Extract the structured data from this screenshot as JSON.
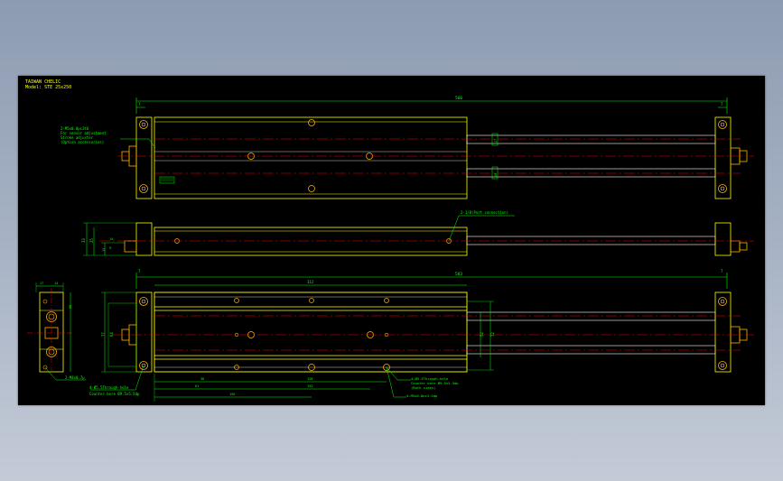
{
  "title_block": {
    "company": "TAIWAN CHELIC",
    "model": "Model: STE 25x250"
  },
  "dimensions": {
    "top_overall": "566",
    "top_left_offset": "7",
    "top_right_offset": "7",
    "bottom_overall": "583",
    "bottom_left_offset": "7",
    "bottom_right_offset": "7",
    "stroke": "312",
    "side_height_a": "33",
    "side_height_b": "25",
    "side_height_c": "13",
    "bore_small_a": "14",
    "bore_small_b": "9",
    "end_view_a": "17",
    "end_view_b": "14",
    "end_view_height": "50",
    "bottom_h1": "77",
    "bottom_h2": "64",
    "right_h": "72",
    "right_h2": "52",
    "dim_36": "36",
    "dim_61": "61",
    "dim_128": "128",
    "dim_152": "152",
    "dim_156": "156",
    "top_small_1": "27",
    "top_small_2": "20"
  },
  "annotations": {
    "callout_top_1": "2-M5x0.8pc3t6",
    "callout_top_2": "For sensor adjustment",
    "callout_top_3": "Stroke adjuster",
    "callout_top_4": "(Option accessories)",
    "port": "2-1/8(Port connection)",
    "end_tap": "2-M4x0.7p",
    "cbore_1": "4-Ø5.5Through-hole",
    "cbore_2": "Counter bore Ø9.5x5.5dp",
    "right_1": "4-Ø5.5Through-hole",
    "right_2": "Counter bore Ø9.5x5.5dp",
    "right_3": "(Both sides)",
    "right_4": "4-M5x0.8pc3.5dp"
  },
  "colors": {
    "background": "#000000",
    "outline": "#ffff00",
    "dimension": "#00ff00",
    "centerline": "#ff0000",
    "detail": "#ffffff",
    "hardware": "#ffb000"
  }
}
